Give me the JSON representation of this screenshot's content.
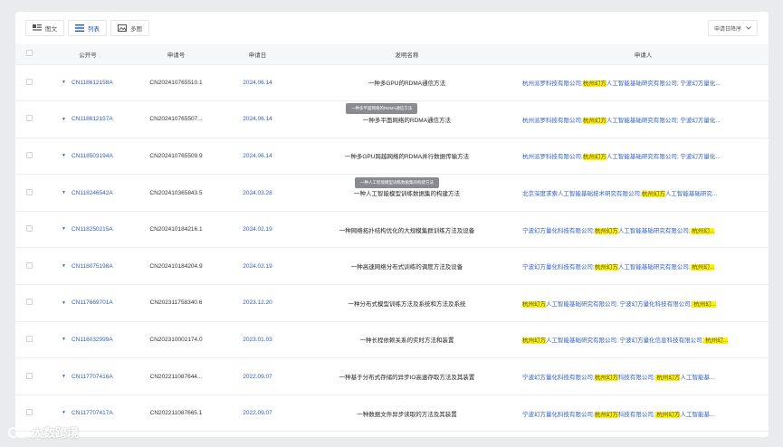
{
  "toolbar": {
    "views": [
      {
        "label": "图文",
        "icon": "image-text-icon"
      },
      {
        "label": "列表",
        "icon": "list-icon"
      },
      {
        "label": "多图",
        "icon": "image-icon"
      }
    ],
    "sort_label": "申请日降序"
  },
  "columns": {
    "pub_no": "公开号",
    "app_no": "申请号",
    "app_date": "申请日",
    "title": "发明名称",
    "applicant": "申请人"
  },
  "rows": [
    {
      "pub_no": "CN118612158A",
      "app_no": "CN202410765510.1",
      "date": "2024.06.14",
      "title": "一种多GPU的RDMA通信方法",
      "applicants": [
        {
          "t": "杭州派罗科技有限公司;",
          "hl": false
        },
        {
          "t": "杭州幻方",
          "hl": true
        },
        {
          "t": "人工智能基础研究有限公司;",
          "hl": false
        },
        {
          "t": " 宁波幻方量化...",
          "hl": false
        }
      ]
    },
    {
      "pub_no": "CN118612157A",
      "app_no": "CN202410765507...",
      "date": "2024.06.14",
      "title": "一种多平面网络的RDMA通信方法",
      "applicants": [
        {
          "t": "杭州派罗科技有限公司;",
          "hl": false
        },
        {
          "t": "杭州幻方",
          "hl": true
        },
        {
          "t": "人工智能基础研究有限公司;",
          "hl": false
        },
        {
          "t": " 宁波幻方量化...",
          "hl": false
        }
      ]
    },
    {
      "pub_no": "CN118503194A",
      "app_no": "CN202410765509.9",
      "date": "2024.06.14",
      "title": "一种多GPU跨越网络的RDMA并行数据传输方法",
      "applicants": [
        {
          "t": "杭州派罗科技有限公司;",
          "hl": false
        },
        {
          "t": "杭州幻方",
          "hl": true
        },
        {
          "t": "人工智能基础研究有限公司;",
          "hl": false
        },
        {
          "t": " 宁波幻方量化...",
          "hl": false
        }
      ]
    },
    {
      "pub_no": "CN118246542A",
      "app_no": "CN202410365843.5",
      "date": "2024.03.28",
      "title": "一种人工智能模型训练数据集的构建方法",
      "applicants": [
        {
          "t": "北京深度求索人工智能基础技术研究有限公司;",
          "hl": false
        },
        {
          "t": "杭州幻方",
          "hl": true
        },
        {
          "t": "人工智能基础研究...",
          "hl": false
        }
      ]
    },
    {
      "pub_no": "CN118250215A",
      "app_no": "CN202410184216.1",
      "date": "2024.02.19",
      "title": "一种网络拓扑结构优化的大规模集群训练方法及设备",
      "applicants": [
        {
          "t": "宁波幻方量化科技有限公司;",
          "hl": false
        },
        {
          "t": "杭州幻方",
          "hl": true
        },
        {
          "t": "人工智能基础研究有限公司;",
          "hl": false
        },
        {
          "t": " 杭州幻...",
          "hl": true
        }
      ]
    },
    {
      "pub_no": "CN118075198A",
      "app_no": "CN202410184204.9",
      "date": "2024.02.19",
      "title": "一种高速网络分布式训练的调度方法及设备",
      "applicants": [
        {
          "t": "宁波幻方量化科技有限公司;",
          "hl": false
        },
        {
          "t": "杭州幻方",
          "hl": true
        },
        {
          "t": "人工智能基础研究有限公司;",
          "hl": false
        },
        {
          "t": " 杭州幻...",
          "hl": true
        }
      ]
    },
    {
      "pub_no": "CN117669701A",
      "app_no": "CN202311758340.6",
      "date": "2023.12.20",
      "title": "一种分布式模型训练方法及系统和方法及系统",
      "applicants": [
        {
          "t": "杭州幻方",
          "hl": true
        },
        {
          "t": "人工智能基础研究有限公司;",
          "hl": false
        },
        {
          "t": " 宁波幻方量化科技有限公司;",
          "hl": false
        },
        {
          "t": " 杭州幻...",
          "hl": true
        }
      ]
    },
    {
      "pub_no": "CN116032999A",
      "app_no": "CN202310002174.0",
      "date": "2023.01.03",
      "title": "一种长程依赖关系的实时方法和装置",
      "applicants": [
        {
          "t": "杭州幻方",
          "hl": true
        },
        {
          "t": "人工智能基础研究有限公司;",
          "hl": false
        },
        {
          "t": " 宁波幻方量化信息科技有限公司;",
          "hl": false
        },
        {
          "t": " 杭州幻...",
          "hl": true
        }
      ]
    },
    {
      "pub_no": "CN117707416A",
      "app_no": "CN202211087644...",
      "date": "2022.09.07",
      "title": "一种基于分布式存储的异步IO高速存取方法及其装置",
      "applicants": [
        {
          "t": "宁波幻方量化科技有限公司;",
          "hl": false
        },
        {
          "t": "杭州幻方",
          "hl": true
        },
        {
          "t": "科技有限公司;",
          "hl": false
        },
        {
          "t": " 杭州幻方",
          "hl": true
        },
        {
          "t": "人工智能基...",
          "hl": false
        }
      ]
    },
    {
      "pub_no": "CN117707417A",
      "app_no": "CN202211087665.1",
      "date": "2022.09.07",
      "title": "一种数据文件异步读取的方法及其装置",
      "applicants": [
        {
          "t": "宁波幻方量化科技有限公司;",
          "hl": false
        },
        {
          "t": "杭州幻方",
          "hl": true
        },
        {
          "t": "科技有限公司;",
          "hl": false
        },
        {
          "t": " 杭州幻方",
          "hl": true
        },
        {
          "t": "人工智能基...",
          "hl": false
        }
      ]
    }
  ],
  "tooltips": [
    {
      "text": "一种多平面网络的RDMA通信方法"
    },
    {
      "text": "一种人工智能模型训练数据集的构建方法"
    }
  ],
  "watermark": "大数跨境",
  "colors": {
    "link": "#2f5fc4",
    "highlight": "#fff200"
  }
}
